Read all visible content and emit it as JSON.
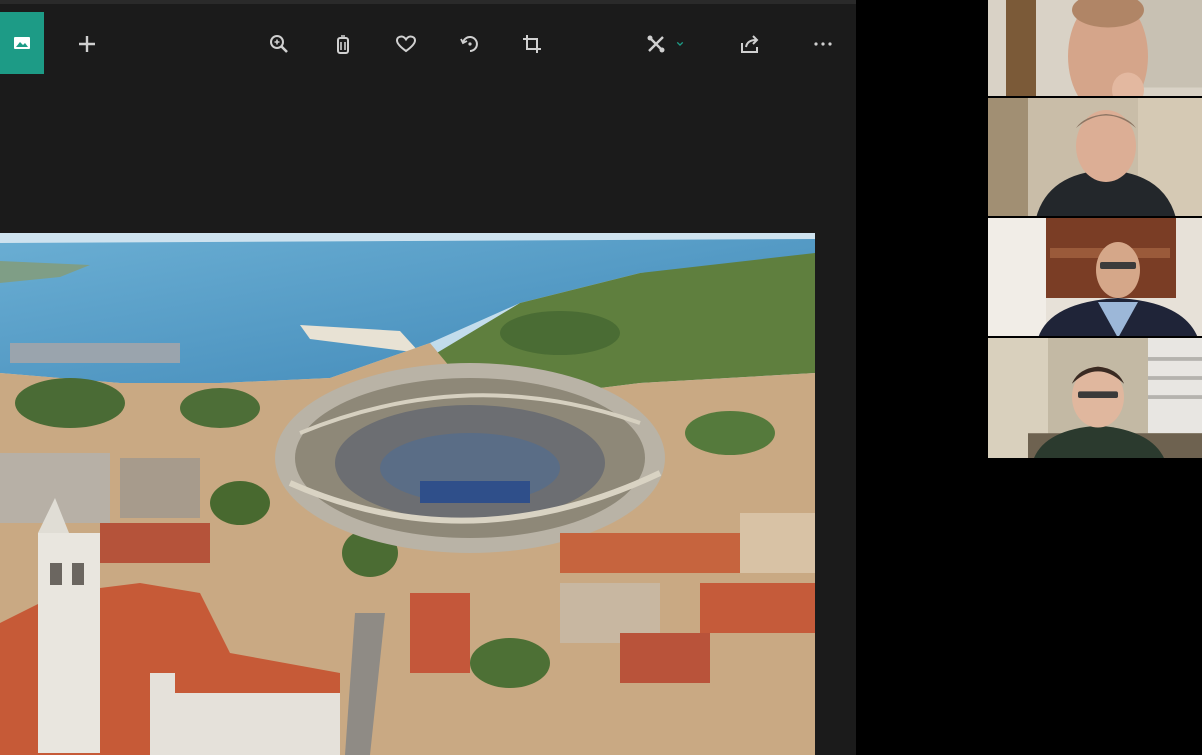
{
  "app": {
    "theme_accent": "#1d9b86",
    "viewer_background": "#1b1b1b"
  },
  "toolbar": {
    "buttons": [
      {
        "icon": "picture-icon",
        "role": "gallery"
      },
      {
        "icon": "plus-icon",
        "role": "add"
      },
      {
        "icon": "zoom-icon",
        "role": "zoom"
      },
      {
        "icon": "trash-icon",
        "role": "delete"
      },
      {
        "icon": "heart-icon",
        "role": "favorite"
      },
      {
        "icon": "rotate-icon",
        "role": "rotate"
      },
      {
        "icon": "crop-icon",
        "role": "crop"
      },
      {
        "icon": "edit-icon",
        "role": "edit"
      },
      {
        "icon": "share-icon",
        "role": "share"
      },
      {
        "icon": "more-icon",
        "role": "more"
      }
    ]
  },
  "shared_image": {
    "subject": "aerial-city-amphitheatre-photo"
  },
  "participants": [
    {
      "id": "participant-1"
    },
    {
      "id": "participant-2"
    },
    {
      "id": "participant-3"
    },
    {
      "id": "participant-4"
    }
  ]
}
